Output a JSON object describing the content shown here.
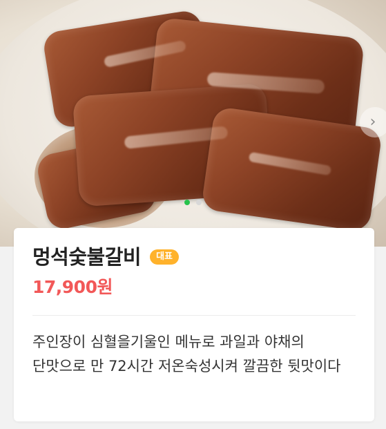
{
  "carousel": {
    "next_icon": "chevron-right-icon",
    "next_glyph": "›",
    "slide_count": 2,
    "active_index": 0,
    "active_color": "#27c24c",
    "inactive_color": "#d8d8d8"
  },
  "menu_item": {
    "name": "멍석숯불갈비",
    "badge": "대표",
    "price": "17,900원",
    "description": "주인장이 심혈을기울인 메뉴로 과일과 야채의 단맛으로 만 72시간 저온숙성시켜 깔끔한 뒷맛이다"
  },
  "colors": {
    "badge_bg": "#ffb22b",
    "price": "#f25858"
  }
}
